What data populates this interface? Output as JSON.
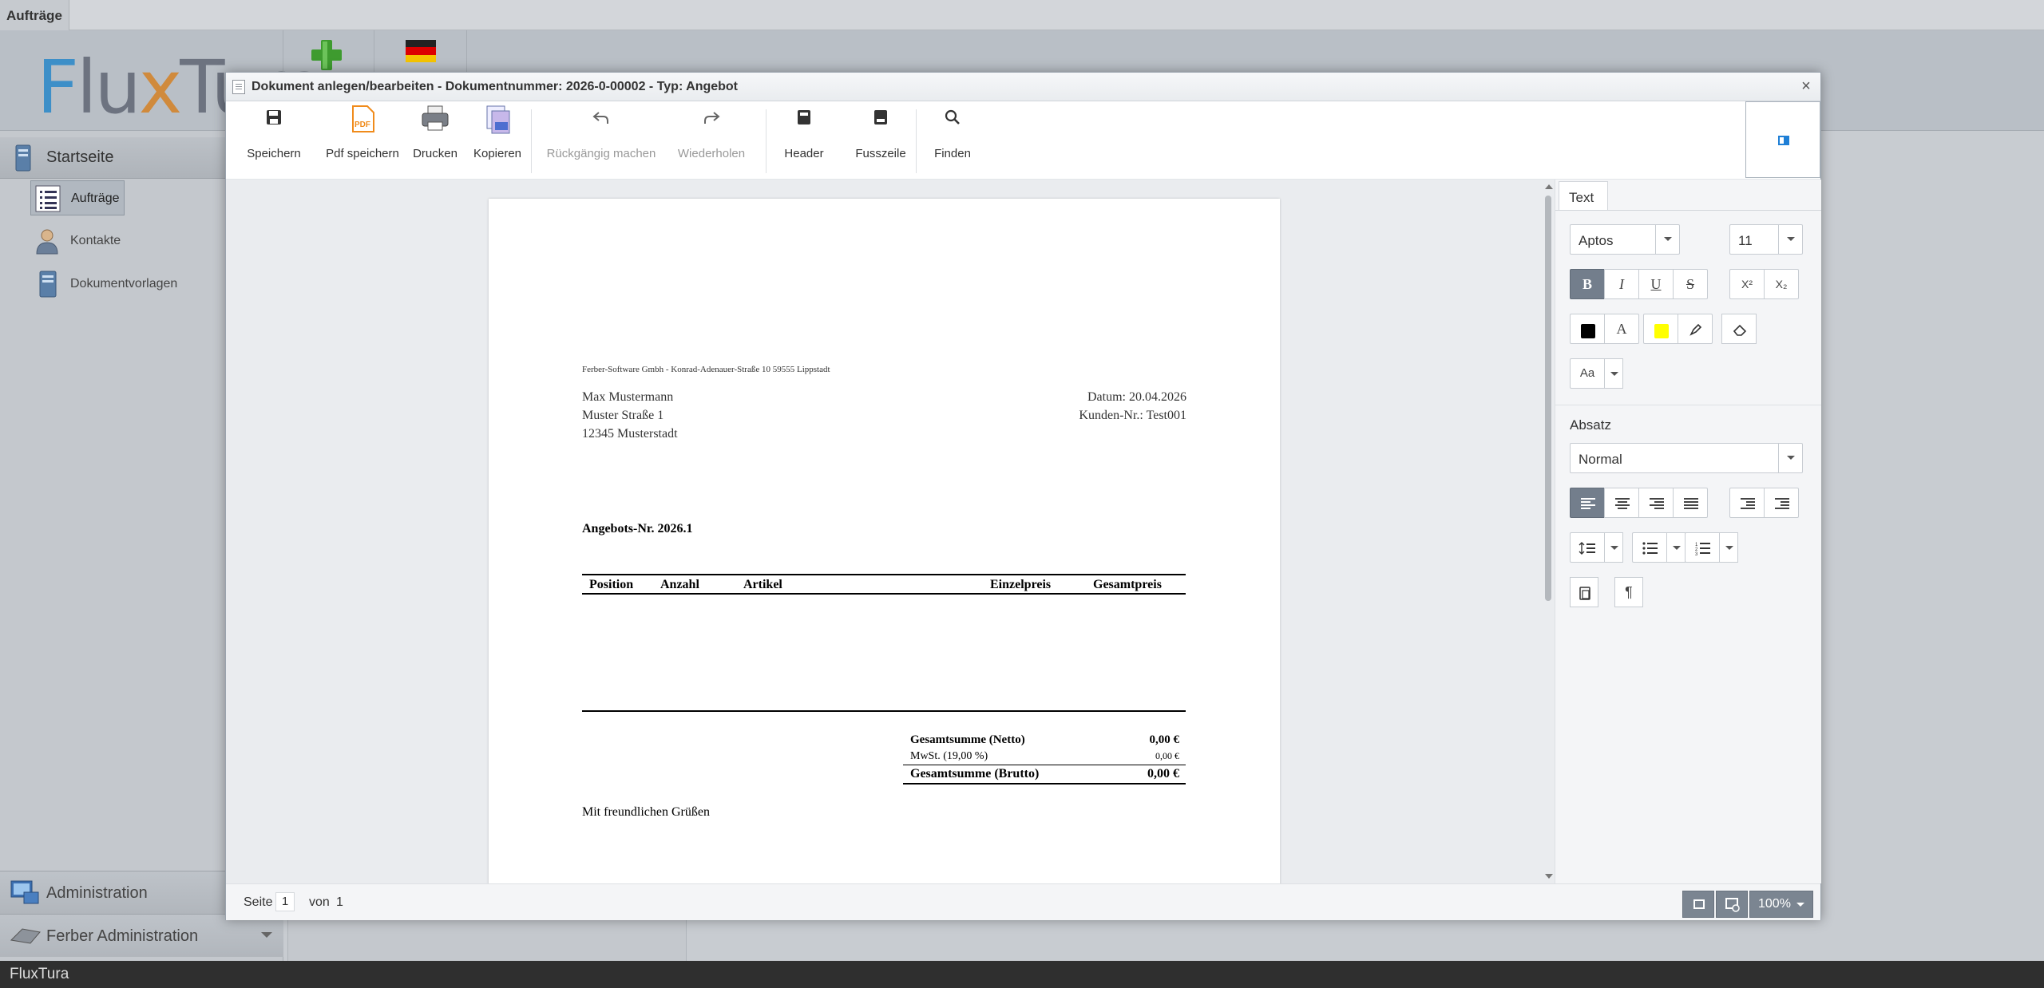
{
  "app": {
    "top_tab": "Aufträge",
    "logo_text": "FluxTura",
    "status_text": "FluxTura"
  },
  "sidebar": {
    "start": "Startseite",
    "items": [
      {
        "label": "Aufträge",
        "icon": "list-icon",
        "active": true
      },
      {
        "label": "Kontakte",
        "icon": "person-icon",
        "active": false
      },
      {
        "label": "Dokumentvorlagen",
        "icon": "document-server-icon",
        "active": false
      }
    ],
    "admin": "Administration",
    "ferber_admin": "Ferber Administration"
  },
  "dialog": {
    "title": "Dokument anlegen/bearbeiten - Dokumentnummer: 2026-0-00002 - Typ: Angebot",
    "close_label": "×",
    "toolbar": {
      "save": "Speichern",
      "pdf_save": "Pdf speichern",
      "print": "Drucken",
      "copy": "Kopieren",
      "undo": "Rückgängig machen",
      "redo": "Wiederholen",
      "header": "Header",
      "footer": "Fusszeile",
      "find": "Finden"
    }
  },
  "document": {
    "sender_line": "Ferber-Software Gmbh - Konrad-Adenauer-Straße 10 59555 Lippstadt",
    "recipient": [
      "Max Mustermann",
      "Muster Straße 1",
      "12345 Musterstadt"
    ],
    "date": "Datum: 20.04.2026",
    "customer_no": "Kunden-Nr.: Test001",
    "offer_no": "Angebots-Nr. 2026.1",
    "table_headers": [
      "Position",
      "Anzahl",
      "Artikel",
      "Einzelpreis",
      "Gesamtpreis"
    ],
    "totals": {
      "netto_label": "Gesamtsumme (Netto)",
      "netto_value": "0,00 €",
      "mwst_label": "MwSt. (19,00 %)",
      "mwst_value": "0,00 €",
      "brutto_label": "Gesamtsumme (Brutto)",
      "brutto_value": "0,00 €"
    },
    "closing": "Mit freundlichen Grüßen"
  },
  "format_panel": {
    "tab": "Text",
    "font_family": "Aptos",
    "font_size": "11",
    "bold_label": "B",
    "italic_label": "I",
    "underline_label": "U",
    "strike_label": "S",
    "superscript_label": "X²",
    "subscript_label": "X₂",
    "font_color_label": "A",
    "case_label": "Aa",
    "font_color": "#000000",
    "highlight_color": "#ffff00",
    "paragraph_label": "Absatz",
    "paragraph_style": "Normal",
    "pilcrow_label": "¶"
  },
  "status": {
    "page_label": "Seite",
    "page_current": "1",
    "of_label": "von",
    "page_total": "1",
    "zoom": "100%"
  }
}
